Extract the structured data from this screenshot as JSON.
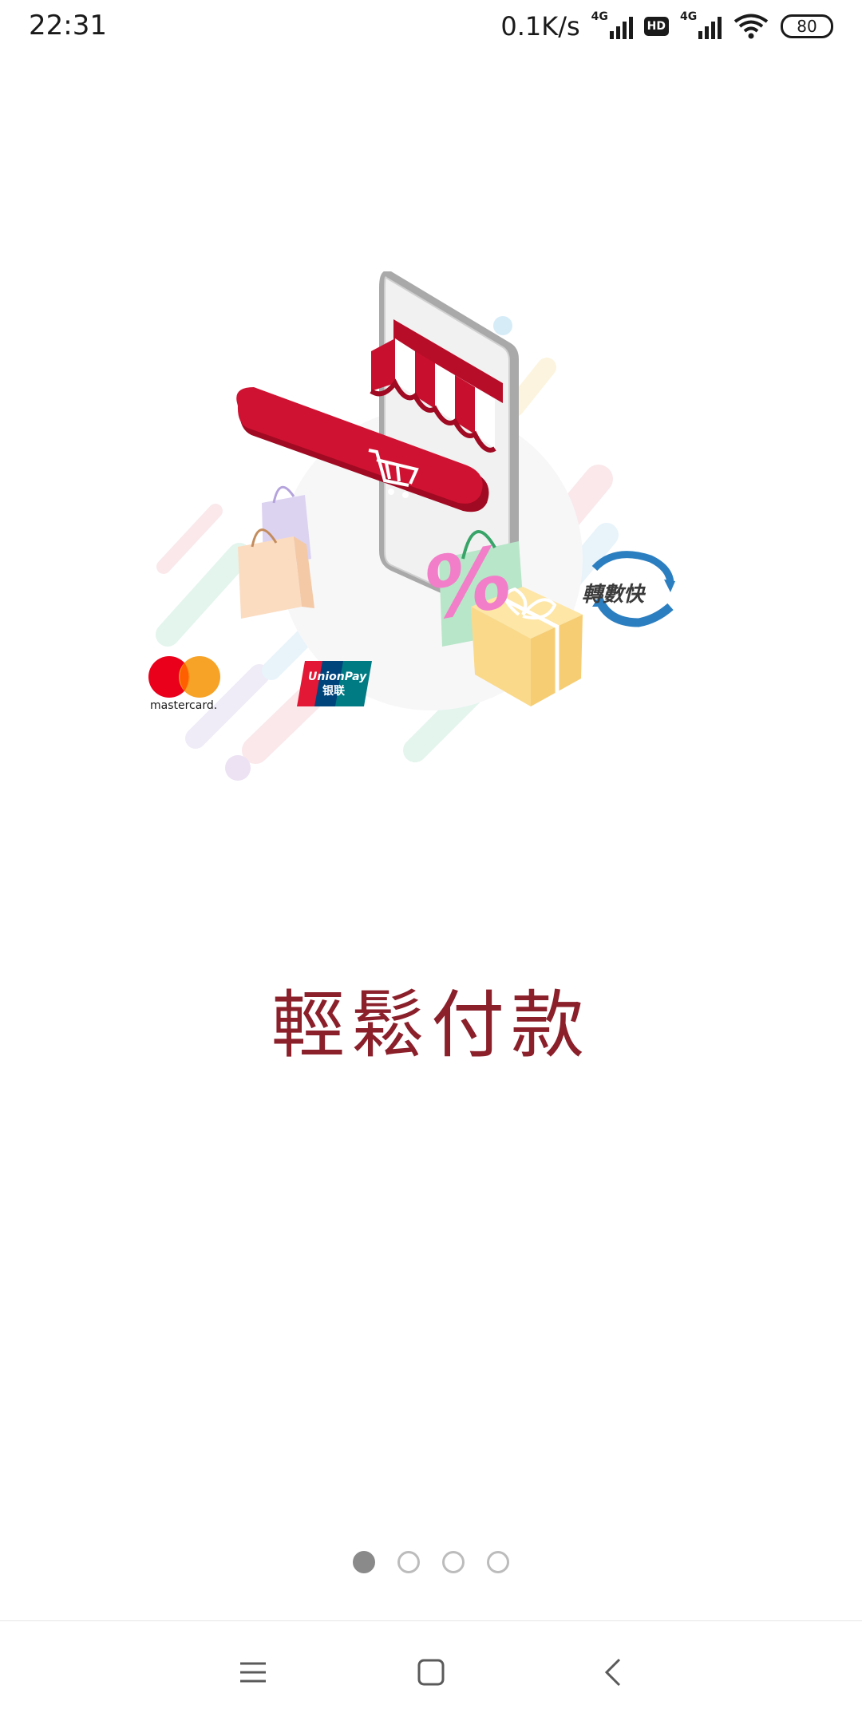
{
  "status_bar": {
    "time": "22:31",
    "net_speed": "0.1K/s",
    "sim1_network": "4G",
    "hd_badge": "HD",
    "sim2_network": "4G",
    "battery": "80"
  },
  "illustration": {
    "mastercard_label": "mastercard.",
    "unionpay_label": "UnionPay",
    "unionpay_cn": "银联",
    "fps_label": "轉數快",
    "percent_sign": "%"
  },
  "onboarding": {
    "title": "輕鬆付款",
    "page_count": 4,
    "active_page": 1
  },
  "colors": {
    "title": "#8b1f2a",
    "awning_red": "#c8102e",
    "dot_active": "#8a8a8a",
    "dot_inactive": "#bcbcbc"
  },
  "navbar": {
    "menu_icon": "menu-icon",
    "home_icon": "home-square-icon",
    "back_icon": "back-chevron-icon"
  }
}
